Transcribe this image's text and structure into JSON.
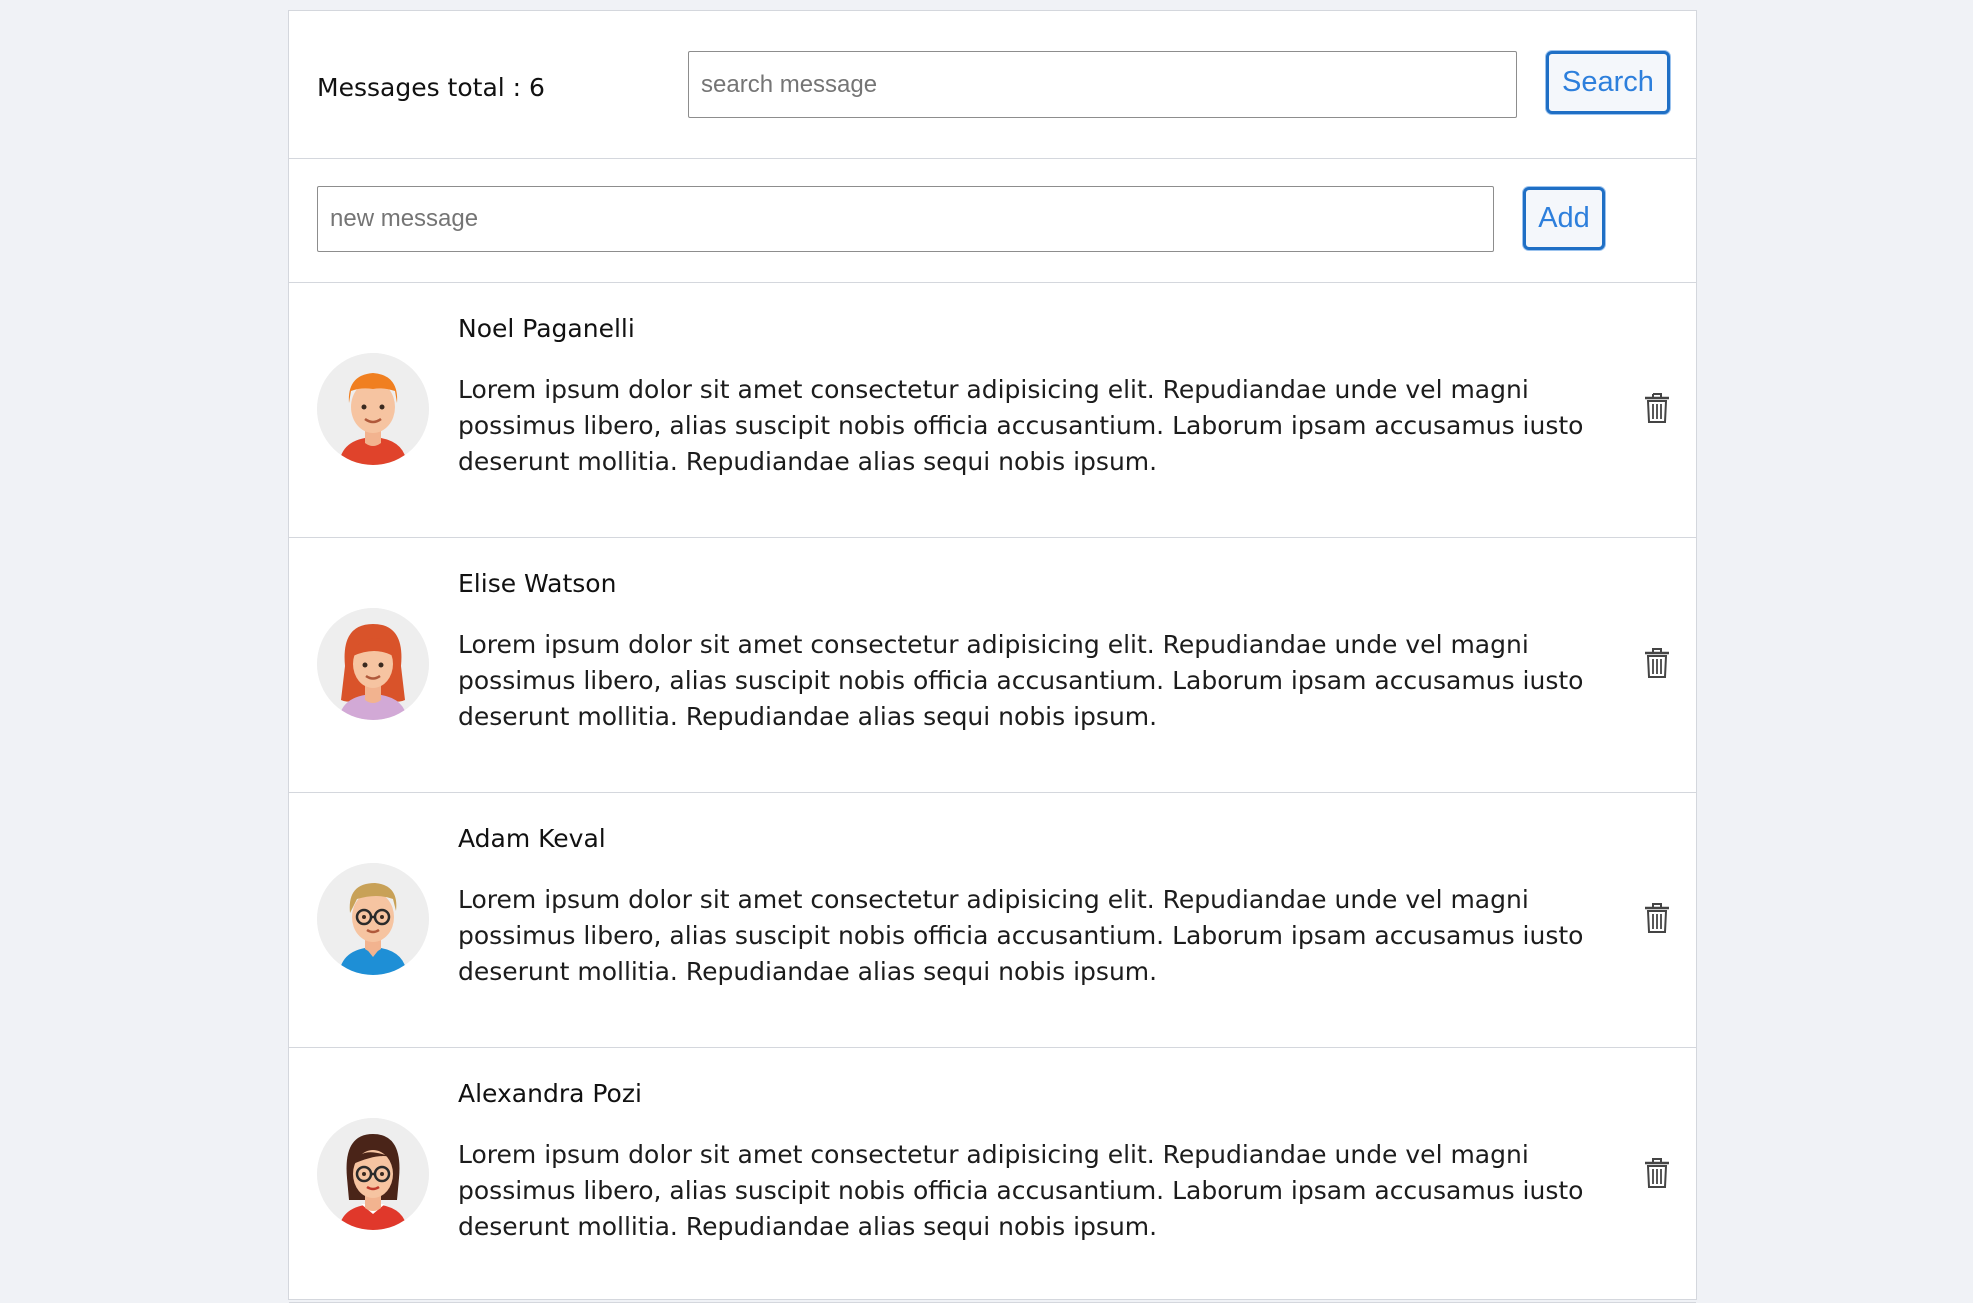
{
  "header": {
    "total_label": "Messages total : 6",
    "search_placeholder": "search message",
    "search_button": "Search"
  },
  "composer": {
    "new_placeholder": "new message",
    "add_button": "Add"
  },
  "messages": [
    {
      "name": "Noel Paganelli",
      "text": "Lorem ipsum dolor sit amet consectetur adipisicing elit. Repudiandae unde vel magni possimus libero, alias suscipit nobis officia accusantium. Laborum ipsam accusamus iusto deserunt mollitia. Repudiandae alias sequi nobis ipsum.",
      "avatar_icon": "man-orange-hair-avatar-icon"
    },
    {
      "name": "Elise Watson",
      "text": "Lorem ipsum dolor sit amet consectetur adipisicing elit. Repudiandae unde vel magni possimus libero, alias suscipit nobis officia accusantium. Laborum ipsam accusamus iusto deserunt mollitia. Repudiandae alias sequi nobis ipsum.",
      "avatar_icon": "woman-red-hair-avatar-icon"
    },
    {
      "name": "Adam Keval",
      "text": "Lorem ipsum dolor sit amet consectetur adipisicing elit. Repudiandae unde vel magni possimus libero, alias suscipit nobis officia accusantium. Laborum ipsam accusamus iusto deserunt mollitia. Repudiandae alias sequi nobis ipsum.",
      "avatar_icon": "man-glasses-avatar-icon"
    },
    {
      "name": "Alexandra Pozi",
      "text": "Lorem ipsum dolor sit amet consectetur adipisicing elit. Repudiandae unde vel magni possimus libero, alias suscipit nobis officia accusantium. Laborum ipsam accusamus iusto deserunt mollitia. Repudiandae alias sequi nobis ipsum.",
      "avatar_icon": "woman-glasses-avatar-icon"
    }
  ],
  "colors": {
    "accent": "#2d7fdc",
    "accent_border": "#1f6fc5",
    "page_background": "#f0f2f6"
  }
}
